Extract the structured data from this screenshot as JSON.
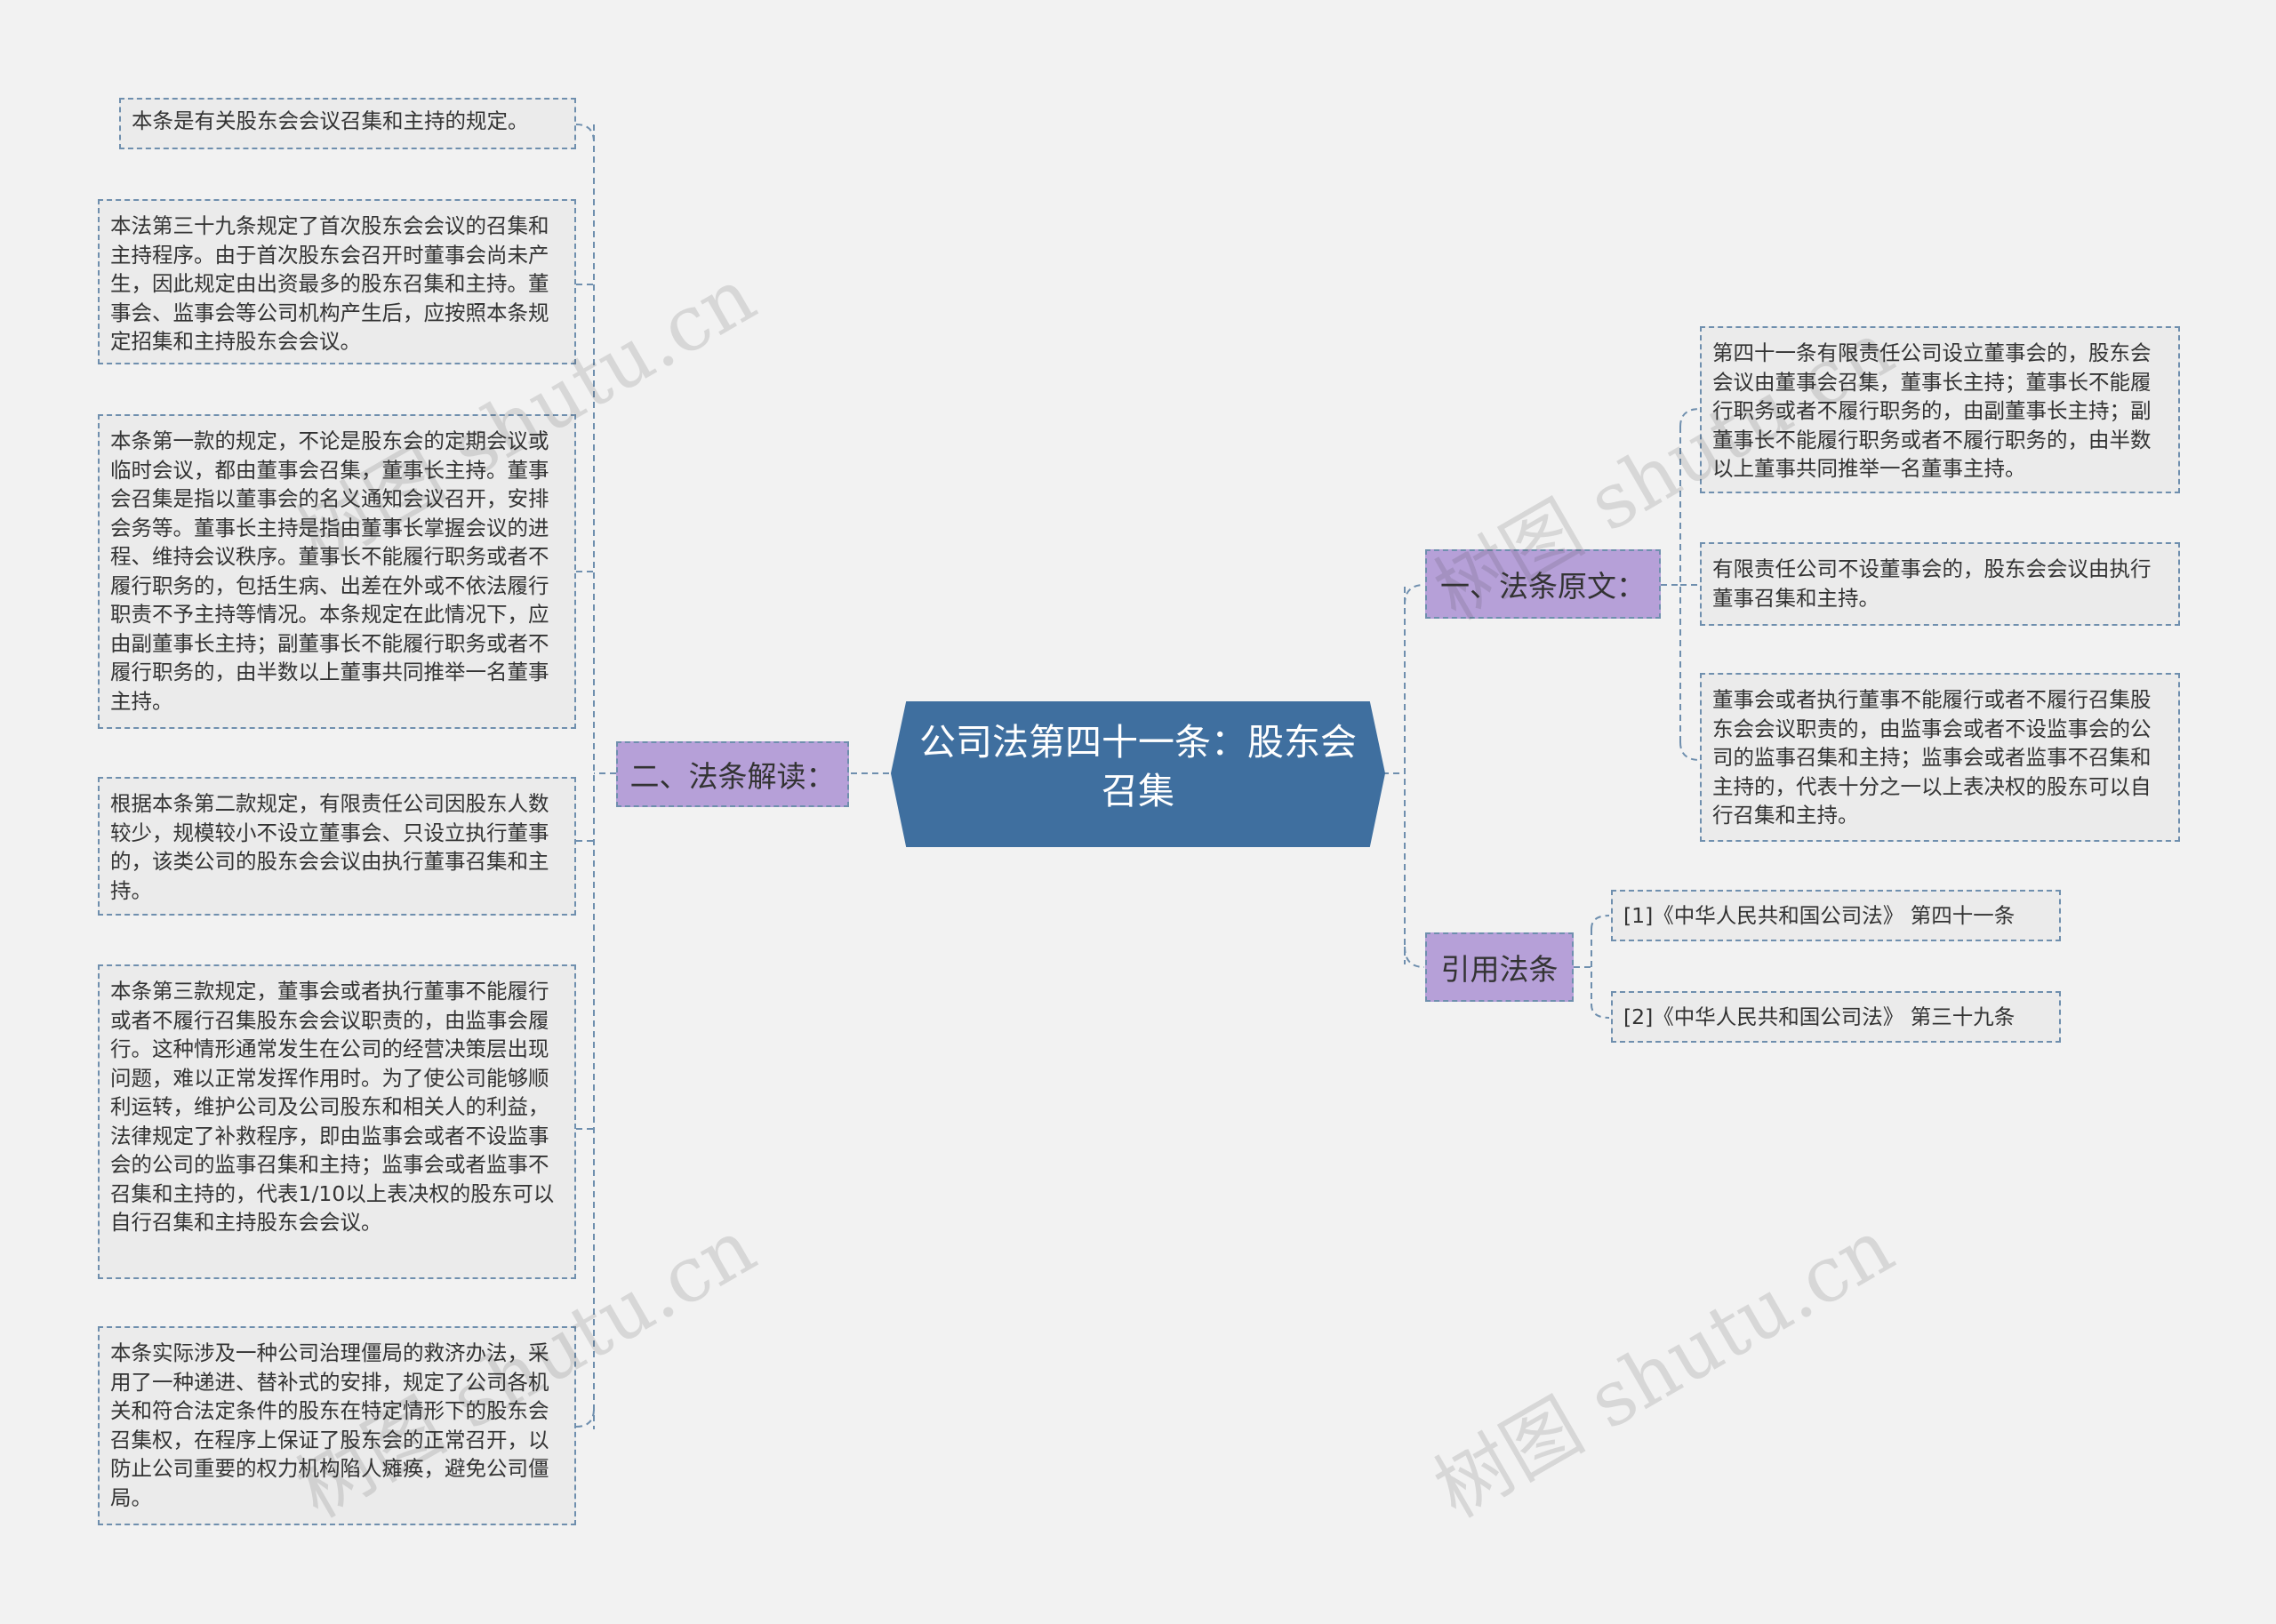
{
  "root": {
    "title": "公司法第四十一条：股东会召集"
  },
  "branches": {
    "interpretation": "二、法条解读：",
    "original": "一、法条原文：",
    "references": "引用法条"
  },
  "interpretation_items": [
    "本条是有关股东会会议召集和主持的规定。",
    "本法第三十九条规定了首次股东会会议的召集和主持程序。由于首次股东会召开时董事会尚未产生，因此规定由出资最多的股东召集和主持。董事会、监事会等公司机构产生后，应按照本条规定招集和主持股东会会议。",
    "本条第一款的规定，不论是股东会的定期会议或临时会议，都由董事会召集，董事长主持。董事会召集是指以董事会的名义通知会议召开，安排会务等。董事长主持是指由董事长掌握会议的进程、维持会议秩序。董事长不能履行职务或者不履行职务的，包括生病、出差在外或不依法履行职责不予主持等情况。本条规定在此情况下，应由副董事长主持；副董事长不能履行职务或者不履行职务的，由半数以上董事共同推举一名董事主持。",
    "根据本条第二款规定，有限责任公司因股东人数较少，规模较小不设立董事会、只设立执行董事的，该类公司的股东会会议由执行董事召集和主持。",
    "本条第三款规定，董事会或者执行董事不能履行或者不履行召集股东会会议职责的，由监事会履行。这种情形通常发生在公司的经营决策层出现问题，难以正常发挥作用时。为了使公司能够顺利运转，维护公司及公司股东和相关人的利益，法律规定了补救程序，即由监事会或者不设监事会的公司的监事召集和主持；监事会或者监事不召集和主持的，代表1/10以上表决权的股东可以自行召集和主持股东会会议。",
    "本条实际涉及一种公司治理僵局的救济办法，采用了一种递进、替补式的安排，规定了公司各机关和符合法定条件的股东在特定情形下的股东会召集权，在程序上保证了股东会的正常召开，以防止公司重要的权力机构陷人瘫痪，避免公司僵局。"
  ],
  "original_items": [
    "第四十一条有限责任公司设立董事会的，股东会会议由董事会召集，董事长主持；董事长不能履行职务或者不履行职务的，由副董事长主持；副董事长不能履行职务或者不履行职务的，由半数以上董事共同推举一名董事主持。",
    "有限责任公司不设董事会的，股东会会议由执行董事召集和主持。",
    "董事会或者执行董事不能履行或者不履行召集股东会会议职责的，由监事会或者不设监事会的公司的监事召集和主持；监事会或者监事不召集和主持的，代表十分之一以上表决权的股东可以自行召集和主持。"
  ],
  "reference_items": [
    "[1]《中华人民共和国公司法》 第四十一条",
    "[2]《中华人民共和国公司法》 第三十九条"
  ],
  "watermark": "树图 shutu.cn",
  "colors": {
    "root_fill": "#3f6f9f",
    "branch_fill": "#b6a0d8",
    "leaf_fill": "#ebebeb",
    "border": "#6f8fae",
    "line": "#6f8fae",
    "background": "#f2f2f2"
  }
}
